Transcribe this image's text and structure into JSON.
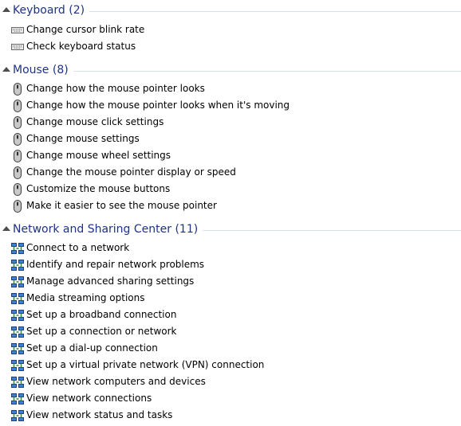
{
  "groups": [
    {
      "title": "Keyboard (2)",
      "icon": "keyboard-icon",
      "items": [
        "Change cursor blink rate",
        "Check keyboard status"
      ]
    },
    {
      "title": "Mouse (8)",
      "icon": "mouse-icon",
      "items": [
        "Change how the mouse pointer looks",
        "Change how the mouse pointer looks when it's moving",
        "Change mouse click settings",
        "Change mouse settings",
        "Change mouse wheel settings",
        "Change the mouse pointer display or speed",
        "Customize the mouse buttons",
        "Make it easier to see the mouse pointer"
      ]
    },
    {
      "title": "Network and Sharing Center (11)",
      "icon": "network-icon",
      "items": [
        "Connect to a network",
        "Identify and repair network problems",
        "Manage advanced sharing settings",
        "Media streaming options",
        "Set up a broadband connection",
        "Set up a connection or network",
        "Set up a dial-up connection",
        "Set up a virtual private network (VPN) connection",
        "View network computers and devices",
        "View network connections",
        "View network status and tasks"
      ]
    }
  ],
  "colors": {
    "header_text": "#1e3287",
    "rule": "#dde4ee"
  }
}
